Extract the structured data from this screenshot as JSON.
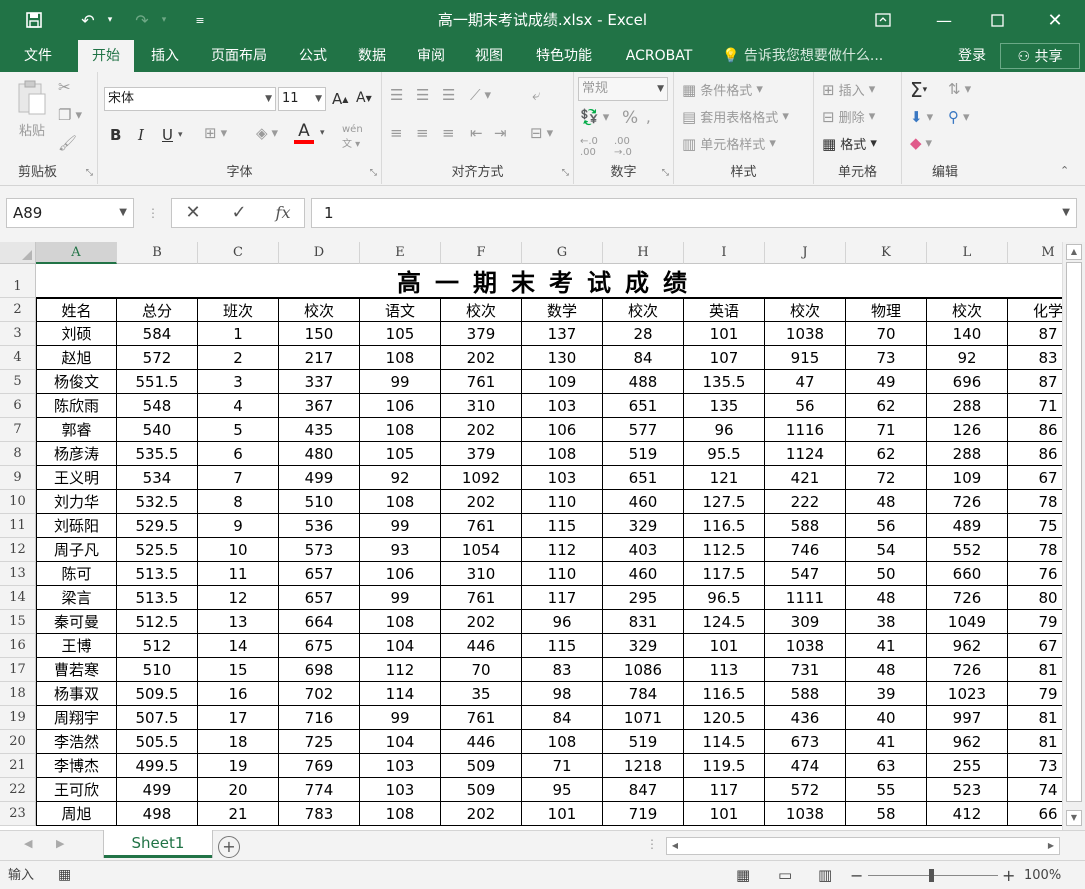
{
  "window": {
    "title": "高一期末考试成绩.xlsx - Excel"
  },
  "tabs": [
    {
      "label": "文件",
      "active": false
    },
    {
      "label": "开始",
      "active": true
    },
    {
      "label": "插入",
      "active": false
    },
    {
      "label": "页面布局",
      "active": false
    },
    {
      "label": "公式",
      "active": false
    },
    {
      "label": "数据",
      "active": false
    },
    {
      "label": "审阅",
      "active": false
    },
    {
      "label": "视图",
      "active": false
    },
    {
      "label": "特色功能",
      "active": false
    },
    {
      "label": "ACROBAT",
      "active": false
    }
  ],
  "tell_me": "告诉我您想要做什么...",
  "account": {
    "login": "登录",
    "share": "共享"
  },
  "ribbon": {
    "clipboard": {
      "label": "剪贴板",
      "paste": "粘贴"
    },
    "font": {
      "label": "字体",
      "name": "宋体",
      "size": "11",
      "bold": "B",
      "italic": "I",
      "underline": "U",
      "font_color": "A",
      "accent": "#ff0000"
    },
    "alignment": {
      "label": "对齐方式"
    },
    "number": {
      "label": "数字",
      "format": "常规",
      "percent": "%"
    },
    "styles": {
      "label": "样式",
      "conditional": "条件格式",
      "table": "套用表格格式",
      "cell_styles": "单元格样式"
    },
    "cells": {
      "label": "单元格",
      "insert": "插入",
      "delete": "删除",
      "format": "格式"
    },
    "editing": {
      "label": "编辑"
    }
  },
  "formula_bar": {
    "name_box": "A89",
    "fx": "fx",
    "value": "1"
  },
  "sheet": {
    "columns": [
      "A",
      "B",
      "C",
      "D",
      "E",
      "F",
      "G",
      "H",
      "I",
      "J",
      "K",
      "L",
      "M"
    ],
    "title": "高一期末考试成绩",
    "header_row": [
      "姓名",
      "总分",
      "班次",
      "校次",
      "语文",
      "校次",
      "数学",
      "校次",
      "英语",
      "校次",
      "物理",
      "校次",
      "化学"
    ],
    "rows": [
      [
        "刘硕",
        "584",
        "1",
        "150",
        "105",
        "379",
        "137",
        "28",
        "101",
        "1038",
        "70",
        "140",
        "87"
      ],
      [
        "赵旭",
        "572",
        "2",
        "217",
        "108",
        "202",
        "130",
        "84",
        "107",
        "915",
        "73",
        "92",
        "83"
      ],
      [
        "杨俊文",
        "551.5",
        "3",
        "337",
        "99",
        "761",
        "109",
        "488",
        "135.5",
        "47",
        "49",
        "696",
        "87"
      ],
      [
        "陈欣雨",
        "548",
        "4",
        "367",
        "106",
        "310",
        "103",
        "651",
        "135",
        "56",
        "62",
        "288",
        "71"
      ],
      [
        "郭睿",
        "540",
        "5",
        "435",
        "108",
        "202",
        "106",
        "577",
        "96",
        "1116",
        "71",
        "126",
        "86"
      ],
      [
        "杨彦涛",
        "535.5",
        "6",
        "480",
        "105",
        "379",
        "108",
        "519",
        "95.5",
        "1124",
        "62",
        "288",
        "86"
      ],
      [
        "王义明",
        "534",
        "7",
        "499",
        "92",
        "1092",
        "103",
        "651",
        "121",
        "421",
        "72",
        "109",
        "67"
      ],
      [
        "刘力华",
        "532.5",
        "8",
        "510",
        "108",
        "202",
        "110",
        "460",
        "127.5",
        "222",
        "48",
        "726",
        "78"
      ],
      [
        "刘砾阳",
        "529.5",
        "9",
        "536",
        "99",
        "761",
        "115",
        "329",
        "116.5",
        "588",
        "56",
        "489",
        "75"
      ],
      [
        "周子凡",
        "525.5",
        "10",
        "573",
        "93",
        "1054",
        "112",
        "403",
        "112.5",
        "746",
        "54",
        "552",
        "78"
      ],
      [
        "陈可",
        "513.5",
        "11",
        "657",
        "106",
        "310",
        "110",
        "460",
        "117.5",
        "547",
        "50",
        "660",
        "76"
      ],
      [
        "梁言",
        "513.5",
        "12",
        "657",
        "99",
        "761",
        "117",
        "295",
        "96.5",
        "1111",
        "48",
        "726",
        "80"
      ],
      [
        "秦可曼",
        "512.5",
        "13",
        "664",
        "108",
        "202",
        "96",
        "831",
        "124.5",
        "309",
        "38",
        "1049",
        "79"
      ],
      [
        "王博",
        "512",
        "14",
        "675",
        "104",
        "446",
        "115",
        "329",
        "101",
        "1038",
        "41",
        "962",
        "67"
      ],
      [
        "曹若寒",
        "510",
        "15",
        "698",
        "112",
        "70",
        "83",
        "1086",
        "113",
        "731",
        "48",
        "726",
        "81"
      ],
      [
        "杨事双",
        "509.5",
        "16",
        "702",
        "114",
        "35",
        "98",
        "784",
        "116.5",
        "588",
        "39",
        "1023",
        "79"
      ],
      [
        "周翔宇",
        "507.5",
        "17",
        "716",
        "99",
        "761",
        "84",
        "1071",
        "120.5",
        "436",
        "40",
        "997",
        "81"
      ],
      [
        "李浩然",
        "505.5",
        "18",
        "725",
        "104",
        "446",
        "108",
        "519",
        "114.5",
        "673",
        "41",
        "962",
        "81"
      ],
      [
        "李博杰",
        "499.5",
        "19",
        "769",
        "103",
        "509",
        "71",
        "1218",
        "119.5",
        "474",
        "63",
        "255",
        "73"
      ],
      [
        "王可欣",
        "499",
        "20",
        "774",
        "103",
        "509",
        "95",
        "847",
        "117",
        "572",
        "55",
        "523",
        "74"
      ],
      [
        "周旭",
        "498",
        "21",
        "783",
        "108",
        "202",
        "101",
        "719",
        "101",
        "1038",
        "58",
        "412",
        "66"
      ]
    ],
    "tab_name": "Sheet1"
  },
  "status": {
    "mode": "输入",
    "zoom": "100%"
  }
}
